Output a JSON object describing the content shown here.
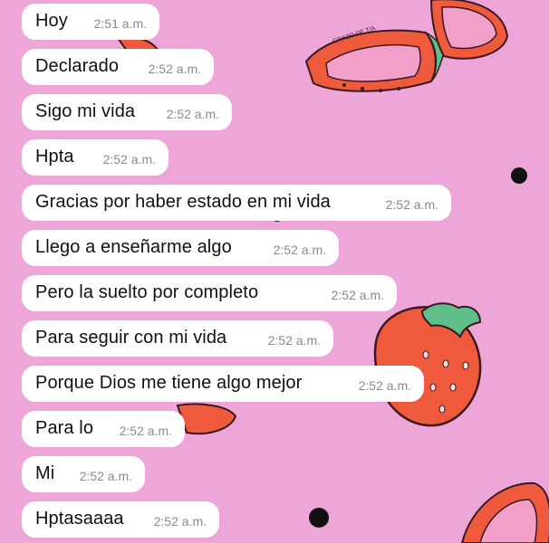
{
  "wallpaper": {
    "background": "#eea5d8",
    "fruit_color": "#f05a3c",
    "leaf_color": "#5fbf8a",
    "ink_color": "#3a1a20",
    "stamp_text": "GRAZO DE T/A"
  },
  "chat": {
    "messages": [
      {
        "text": "Hoy",
        "time": "2:51 a.m."
      },
      {
        "text": "Declarado",
        "time": "2:52 a.m."
      },
      {
        "text": "Sigo mi vida",
        "time": "2:52 a.m."
      },
      {
        "text": "Hpta",
        "time": "2:52 a.m."
      },
      {
        "text": "Gracias por haber estado en mi vida",
        "time": "2:52 a.m."
      },
      {
        "text": "Llego a enseñarme algo",
        "time": "2:52 a.m."
      },
      {
        "text": "Pero la suelto por  completo",
        "time": "2:52 a.m."
      },
      {
        "text": "Para seguir con mi vida",
        "time": "2:52 a.m."
      },
      {
        "text": "Porque Dios me tiene algo mejor",
        "time": "2:52 a.m."
      },
      {
        "text": "Para lo",
        "time": "2:52 a.m."
      },
      {
        "text": "Mi",
        "time": "2:52 a.m."
      },
      {
        "text": "Hptasaaaa",
        "time": "2:52 a.m."
      }
    ]
  }
}
